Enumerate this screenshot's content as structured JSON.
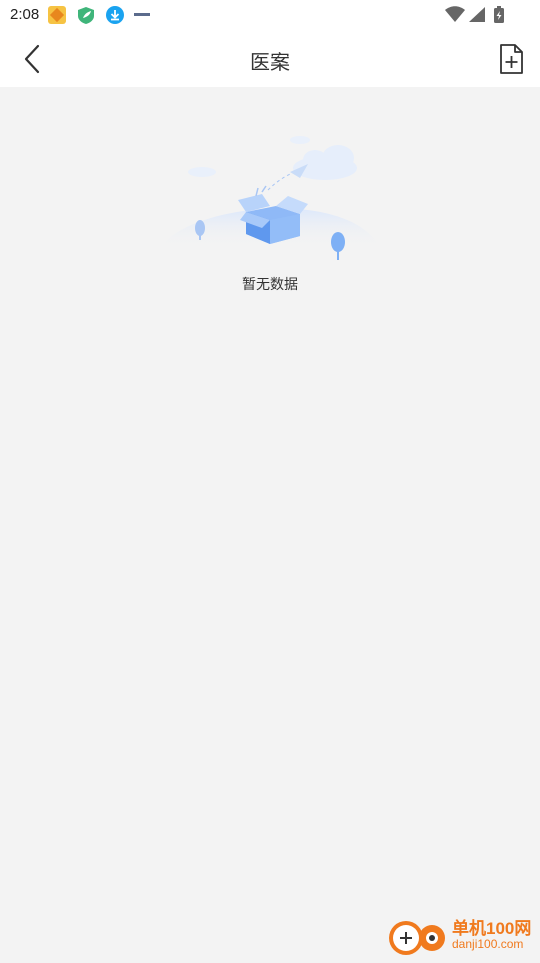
{
  "status_bar": {
    "time": "2:08",
    "notification_icons": [
      "app-badge-icon",
      "shield-leaf-icon",
      "download-icon",
      "small-text-icon"
    ],
    "system_icons": [
      "wifi-icon",
      "signal-icon",
      "battery-icon"
    ]
  },
  "header": {
    "title": "医案",
    "back_icon": "chevron-left-icon",
    "add_icon": "add-document-icon"
  },
  "empty_state": {
    "illustration": "empty-box-illustration",
    "message": "暂无数据"
  },
  "watermark": {
    "line1": "单机100网",
    "line2": "danji100.com"
  },
  "colors": {
    "page_bg": "#f3f3f3",
    "header_bg": "#ffffff",
    "illustration_blue": "#6ea6f5",
    "watermark_orange": "#f07a1e"
  }
}
